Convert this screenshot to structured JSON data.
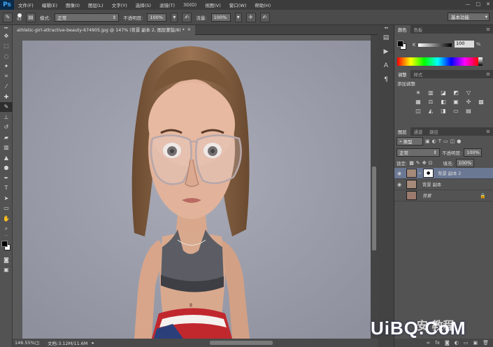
{
  "menubar": {
    "logo": "Ps",
    "items": [
      "文件(F)",
      "编辑(E)",
      "图像(I)",
      "图层(L)",
      "文字(Y)",
      "选择(S)",
      "滤镜(T)",
      "3D(D)",
      "视图(V)",
      "窗口(W)",
      "帮助(H)"
    ],
    "window_buttons": [
      "—",
      "□",
      "✕"
    ]
  },
  "options": {
    "brush_size": "92",
    "mode_label": "模式:",
    "mode_value": "正常",
    "opacity_label": "不透明度:",
    "opacity_value": "100%",
    "flow_label": "流量:",
    "flow_value": "100%",
    "workspace": "基本功能"
  },
  "document": {
    "tab_title": "athletic-girl-attractive-beauty-674905.jpg @ 147% (背景 副本 2, 图层蒙版/8) *",
    "tab_close": "×"
  },
  "statusbar": {
    "zoom": "146.55%",
    "doc_info": "文档:3.12M/11.6M"
  },
  "color_panel": {
    "tabs": [
      "颜色",
      "色板"
    ],
    "channel_label": "K",
    "channel_value": "100",
    "percent": "%"
  },
  "adjustments_panel": {
    "tabs": [
      "调整",
      "样式"
    ],
    "heading": "添加调整"
  },
  "layers_panel": {
    "tabs": [
      "图层",
      "通道",
      "路径"
    ],
    "filter_kind": "类型",
    "blend_mode": "正常",
    "opacity_label": "不透明度:",
    "opacity_value": "100%",
    "lock_label": "锁定:",
    "fill_label": "填充:",
    "fill_value": "100%",
    "layers": [
      {
        "name": "背景 副本 2",
        "visible": true,
        "has_mask": true,
        "selected": true
      },
      {
        "name": "背景 副本",
        "visible": true,
        "has_mask": false,
        "selected": false
      },
      {
        "name": "背景",
        "visible": false,
        "has_mask": false,
        "selected": false
      }
    ]
  },
  "watermark": {
    "text": "UiBQ.CoM",
    "text2": "安 教程"
  }
}
